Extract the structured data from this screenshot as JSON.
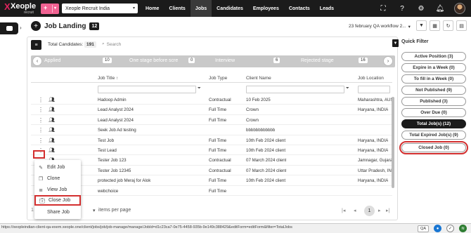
{
  "topbar": {
    "logo": "Xeople",
    "logo_sub": "recruit",
    "org": "Xeople Recruit India",
    "nav": [
      "Home",
      "Clients",
      "Jobs",
      "Candidates",
      "Employees",
      "Contacts",
      "Leads"
    ],
    "active_nav": "Jobs"
  },
  "header": {
    "title": "Job Landing",
    "count": "12",
    "workflow": "23 february QA workflow 2..."
  },
  "toolbar": {
    "total_label": "Total Candidates:",
    "total_value": "191",
    "search_placeholder": "Search"
  },
  "stages": [
    {
      "label": "Applied",
      "count": "10"
    },
    {
      "label": "One stage before scre",
      "count": "0"
    },
    {
      "label": "Interview",
      "count": "6"
    },
    {
      "label": "Rejected stage",
      "count": "16"
    }
  ],
  "table": {
    "columns": [
      "Job Title ↑",
      "Job Type",
      "Client Name",
      "Job Location"
    ],
    "rows": [
      [
        "Hadoop Admin",
        "Contractual",
        "10 Feb 2025",
        "Maharashtra, AUS"
      ],
      [
        "Lead Analyst 2024",
        "Full Time",
        "Crown",
        "Haryana, INDIA"
      ],
      [
        "Lead Analyst 2024",
        "Full Time",
        "Crown",
        ""
      ],
      [
        "Seek Job Ad testing",
        "",
        "bbbbbbbbbbbb",
        ""
      ],
      [
        "Test Job",
        "Full Time",
        "10th Feb 2024 client",
        "Haryana, INDIA"
      ],
      [
        "Test Lead",
        "Full Time",
        "10th Feb 2024 client",
        "Haryana, INDIA"
      ],
      [
        "Tester Job 123",
        "Contractual",
        "07 March 2024 client",
        "Jamnagar, Gujarat"
      ],
      [
        "Tester Job 12345",
        "Contractual",
        "07 March 2024 client",
        "Uttar Pradesh, INI"
      ],
      [
        "protected job Meraj for Alok",
        "Full Time",
        "10th Feb 2024 client",
        "Haryana, INDIA"
      ],
      [
        "webchoice",
        "Full Time",
        "",
        ""
      ]
    ]
  },
  "pager": {
    "page_size_label": "items per page",
    "page_size_prefix": "1",
    "current_page": "1"
  },
  "context_menu": [
    "Edit Job",
    "Clone",
    "View Job",
    "Close Job",
    "Share Job"
  ],
  "quick_filter": {
    "title": "Quick Filter",
    "items": [
      "Active Position (3)",
      "Expire in a Week (0)",
      "To fill in a Week (0)",
      "Not Published (9)",
      "Published (3)",
      "Over Due (0)",
      "Total Job(s) (12)",
      "Total Expired Job(s) (9)",
      "Closed Job (0)"
    ]
  },
  "statusbar": {
    "url": "https://xeopleindian-client-qa-exem.xeople.one/client/jobs/job/job-manage/manage/JobId=d1c23ca7-0e75-4458-935b-9e149c388429&editForm=editForm&filter=TotalJobs",
    "badge": "QA"
  }
}
